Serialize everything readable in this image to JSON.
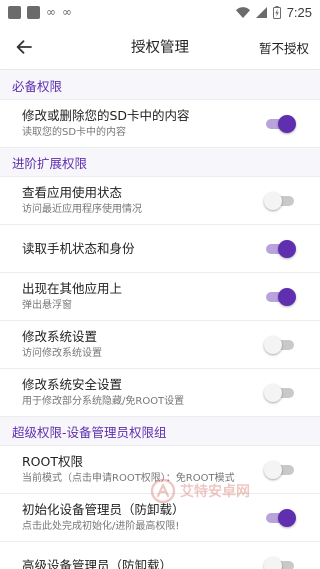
{
  "status_bar": {
    "time": "7:25",
    "icons": [
      "notification-square-icon",
      "notification-square-icon",
      "infinity-icon",
      "infinity-icon",
      "wifi-icon",
      "signal-icon",
      "battery-charging-icon"
    ]
  },
  "app_bar": {
    "back_icon": "back-arrow-icon",
    "title": "授权管理",
    "skip_label": "暂不授权"
  },
  "colors": {
    "accent": "#5f2fb0",
    "accent_track": "#b8a3dc",
    "off_track": "#c9c9c9"
  },
  "sections": [
    {
      "header": "必备权限",
      "items": [
        {
          "title": "修改或删除您的SD卡中的内容",
          "subtitle": "读取您的SD卡中的内容",
          "enabled": true
        }
      ]
    },
    {
      "header": "进阶扩展权限",
      "items": [
        {
          "title": "查看应用使用状态",
          "subtitle": "访问最近应用程序使用情况",
          "enabled": false
        },
        {
          "title": "读取手机状态和身份",
          "subtitle": "",
          "enabled": true
        },
        {
          "title": "出现在其他应用上",
          "subtitle": "弹出悬浮窗",
          "enabled": true
        },
        {
          "title": "修改系统设置",
          "subtitle": "访问修改系统设置",
          "enabled": false
        },
        {
          "title": "修改系统安全设置",
          "subtitle": "用于修改部分系统隐藏/免ROOT设置",
          "enabled": false
        }
      ]
    },
    {
      "header": "超级权限-设备管理员权限组",
      "items": [
        {
          "title": "ROOT权限",
          "subtitle": "当前模式（点击申请ROOT权限）：免ROOT模式",
          "enabled": false
        },
        {
          "title": "初始化设备管理员（防卸载）",
          "subtitle": "点击此处完成初始化/进阶最高权限!",
          "enabled": true
        },
        {
          "title": "高级设备管理员（防卸载）",
          "subtitle": "",
          "enabled": false
        }
      ]
    }
  ],
  "watermark": {
    "text": "艾特安卓网"
  }
}
